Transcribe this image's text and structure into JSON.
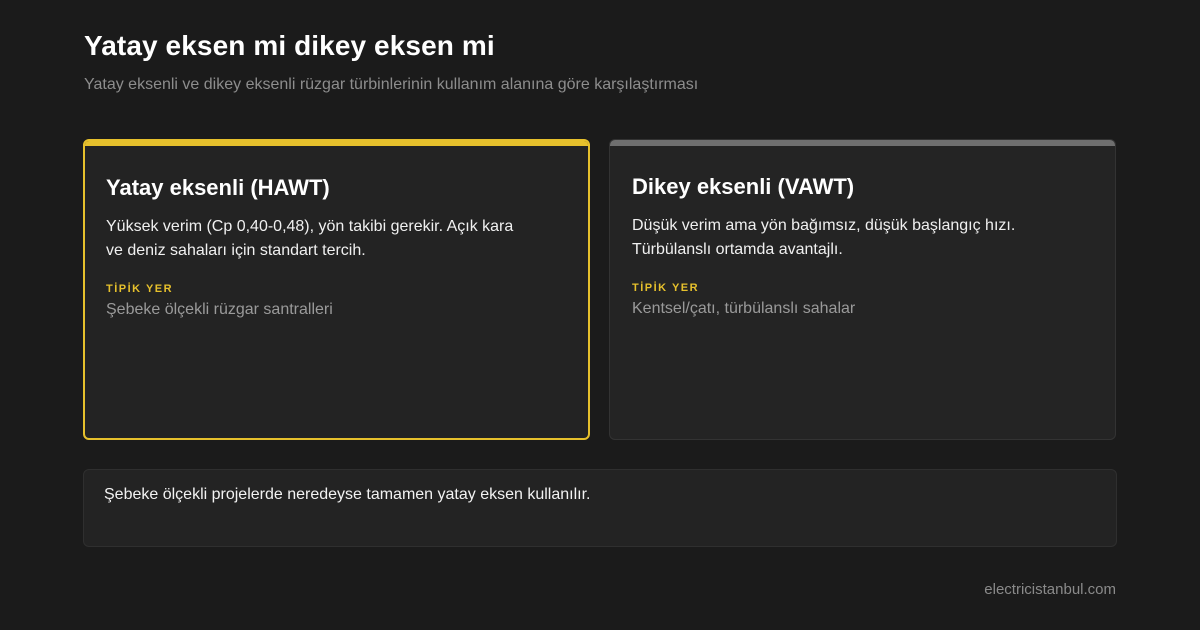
{
  "header": {
    "title": "Yatay eksen mi dikey eksen mi",
    "subtitle": "Yatay eksenli ve dikey eksenli rüzgar türbinlerinin kullanım alanına göre karşılaştırması"
  },
  "cards": [
    {
      "title": "Yatay eksenli (HAWT)",
      "description": "Yüksek verim (Cp 0,40-0,48), yön takibi gerekir. Açık kara ve deniz sahaları için standart tercih.",
      "eyebrow": "TİPİK YER",
      "place": "Şebeke ölçekli rüzgar santralleri",
      "highlighted": true
    },
    {
      "title": "Dikey eksenli (VAWT)",
      "description": "Düşük verim ama yön bağımsız, düşük başlangıç hızı. Türbülanslı ortamda avantajlı.",
      "eyebrow": "TİPİK YER",
      "place": "Kentsel/çatı, türbülanslı sahalar",
      "highlighted": false
    }
  ],
  "note": {
    "text": "Şebeke ölçekli projelerde neredeyse tamamen yatay eksen kullanılır."
  },
  "footer": {
    "site": "electricistanbul.com"
  },
  "colors": {
    "background": "#1b1b1b",
    "card": "#242424",
    "accent": "#e6c02c",
    "muted_bar": "#6f6f6f",
    "muted_text": "#8d8d8d"
  }
}
